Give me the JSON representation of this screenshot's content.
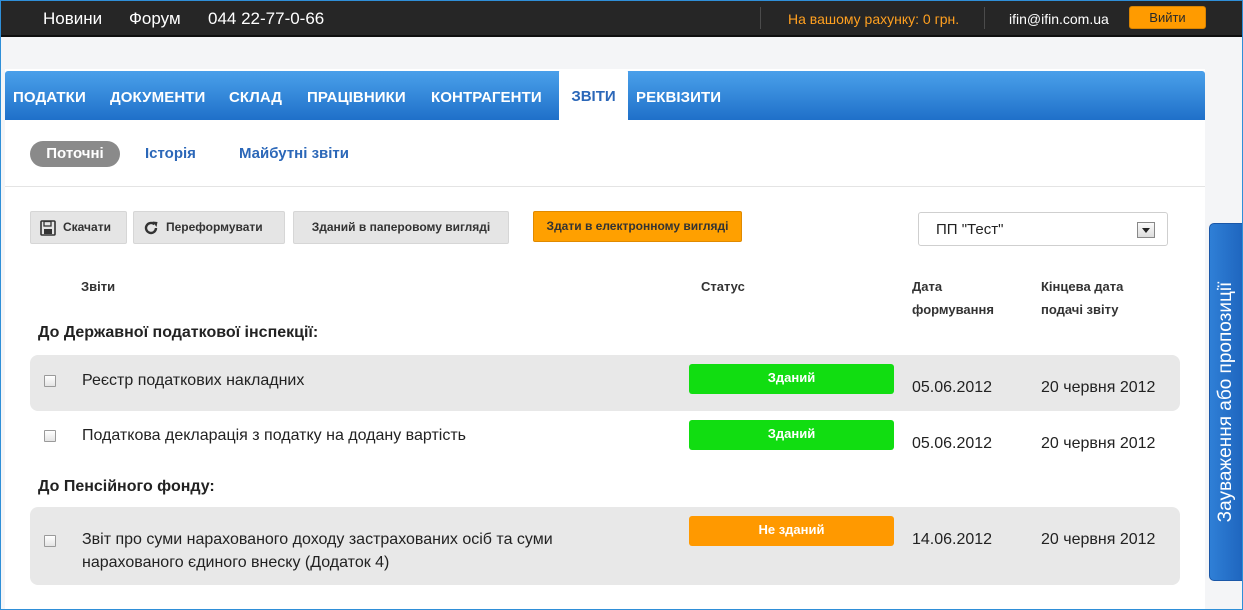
{
  "topbar": {
    "news": "Новини",
    "forum": "Форум",
    "phone": "044 22-77-0-66",
    "balance": "На вашому рахунку: 0 грн.",
    "email": "ifin@ifin.com.ua",
    "logout": "Вийти"
  },
  "nav": {
    "items": [
      "ПОДАТКИ",
      "ДОКУМЕНТИ",
      "СКЛАД",
      "ПРАЦІВНИКИ",
      "КОНТРАГЕНТИ",
      "ЗВІТИ",
      "РЕКВІЗИТИ"
    ],
    "active": "ЗВІТИ"
  },
  "subtabs": {
    "current": "Поточні",
    "history": "Історія",
    "future": "Майбутні звіти"
  },
  "toolbar": {
    "download": "Скачати",
    "reformat": "Переформувати",
    "paper": "Зданий в паперовому вигляді",
    "electronic": "Здати в електронному вигляді",
    "company": "ПП \"Тест\""
  },
  "table": {
    "col_reports": "Звіти",
    "col_status": "Статус",
    "col_date_l1": "Дата",
    "col_date_l2": "формування",
    "col_deadline_l1": "Кінцева дата",
    "col_deadline_l2": "подачі звіту",
    "groups": [
      {
        "title": "До Державної податкової інспекції:",
        "rows": [
          {
            "name": "Реєстр податкових накладних",
            "status": "Зданий",
            "date": "05.06.2012",
            "deadline": "20 червня 2012"
          },
          {
            "name": "Податкова декларація з податку на додану вартість",
            "status": "Зданий",
            "date": "05.06.2012",
            "deadline": "20 червня 2012"
          }
        ]
      },
      {
        "title": "До Пенсійного фонду:",
        "rows": [
          {
            "name_l1": "Звіт про суми нарахованого доходу застрахованих осіб та суми",
            "name_l2": "нарахованого єдиного внеску (Додаток 4)",
            "status": "Не зданий",
            "date": "14.06.2012",
            "deadline": "20 червня 2012"
          }
        ]
      }
    ]
  },
  "sidetab": "Зауваження або пропозиції",
  "colors": {
    "nav": "#2b84dc",
    "status_done": "#11dd11",
    "status_not_done": "#ff9900",
    "accent_orange": "#ff9b00"
  }
}
